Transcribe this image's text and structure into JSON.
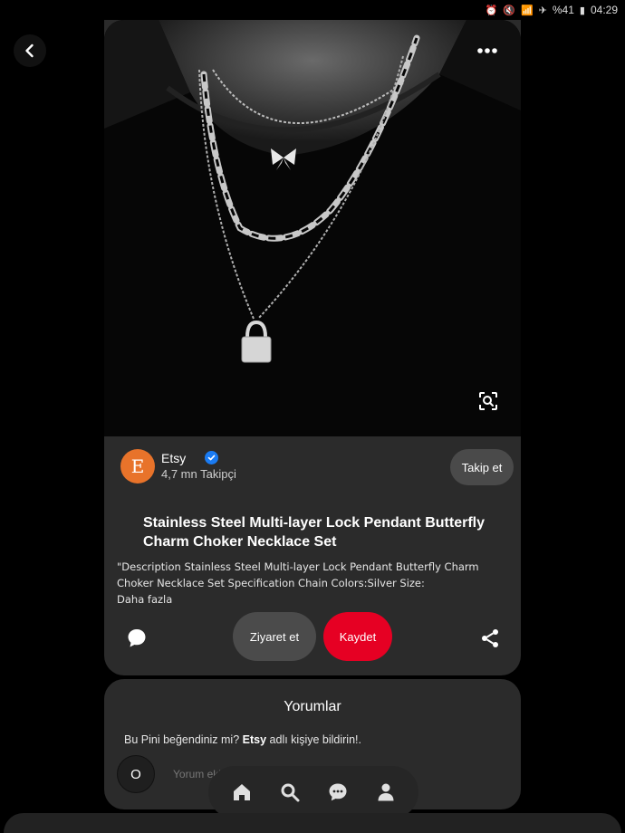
{
  "status_bar": {
    "battery": "%41",
    "time": "04:29"
  },
  "creator": {
    "name": "Etsy",
    "avatar_letter": "E",
    "followers": "4,7 mn Takipçi",
    "follow_label": "Takip et"
  },
  "pin": {
    "title": "Stainless Steel Multi-layer Lock Pendant Butterfly Charm Choker Necklace Set",
    "description": "\"Description Stainless Steel Multi-layer Lock Pendant Butterfly Charm Choker Necklace Set Specification Chain Colors:Silver Size:",
    "more_label": "Daha fazla"
  },
  "actions": {
    "visit_label": "Ziyaret et",
    "save_label": "Kaydet"
  },
  "comments": {
    "title": "Yorumlar",
    "prompt_prefix": "Bu Pini beğendiniz mi?",
    "prompt_brand": "Etsy",
    "prompt_suffix": "adlı kişiye bildirin!.",
    "user_initial": "O",
    "input_placeholder": "Yorum ekle"
  },
  "colors": {
    "save_red": "#e60023",
    "card_bg": "#2b2b2b",
    "avatar_orange": "#e8732a",
    "verified_blue": "#1a7bf2"
  },
  "icons": [
    "chevron-left-icon",
    "more-dots-icon",
    "visual-search-icon",
    "verified-icon",
    "comment-bubble-icon",
    "share-icon",
    "home-icon",
    "search-icon",
    "messages-icon",
    "profile-icon"
  ]
}
